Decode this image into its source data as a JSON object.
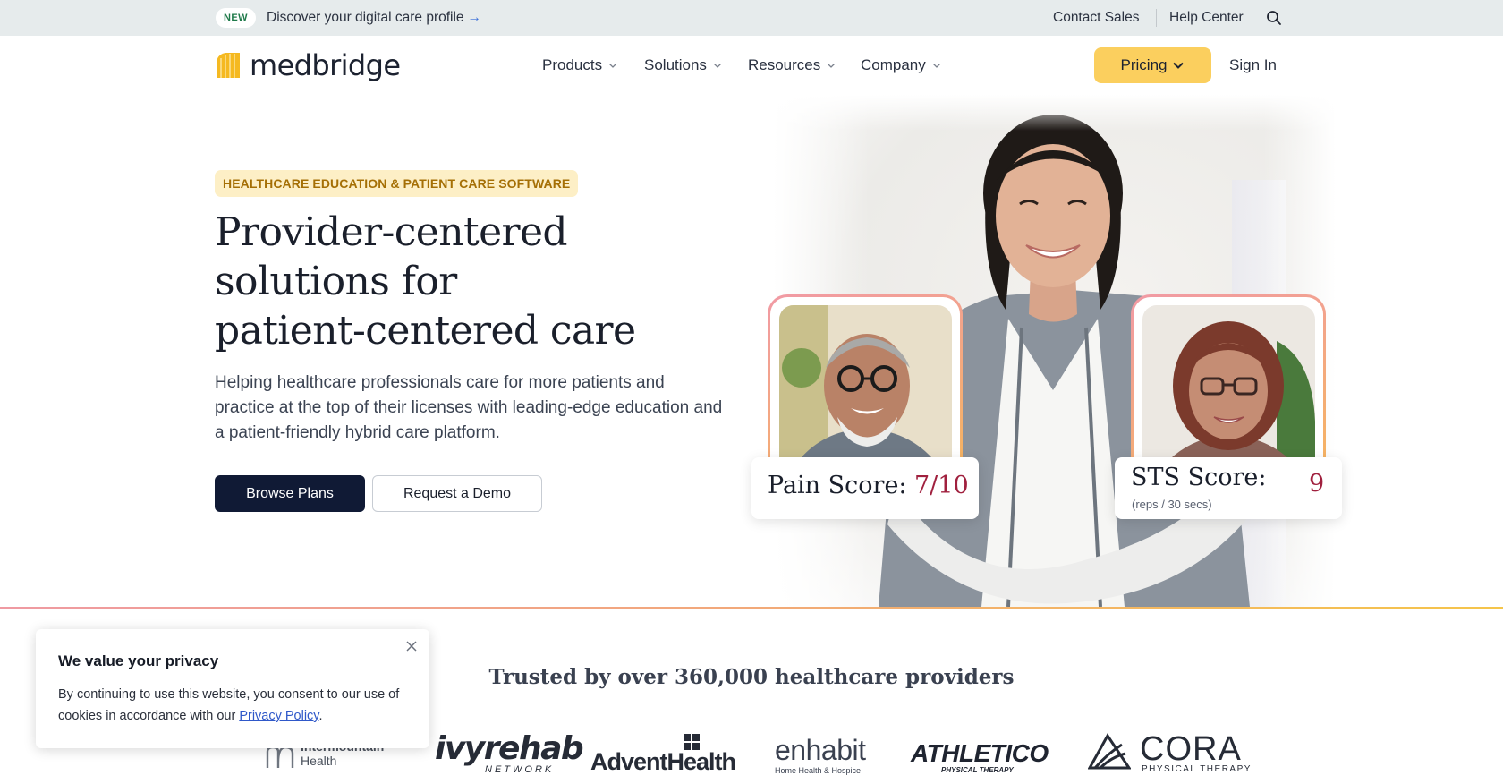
{
  "announcement": {
    "badge": "NEW",
    "text": "Discover your digital care profile",
    "arrow": "→",
    "contact_sales": "Contact Sales",
    "help_center": "Help Center",
    "search_icon": "search-icon"
  },
  "nav": {
    "brand": "medbridge",
    "menu": [
      {
        "label": "Products"
      },
      {
        "label": "Solutions"
      },
      {
        "label": "Resources"
      },
      {
        "label": "Company"
      }
    ],
    "pricing": "Pricing",
    "sign_in": "Sign In"
  },
  "hero": {
    "eyebrow": "HEALTHCARE EDUCATION & PATIENT CARE SOFTWARE",
    "headline_line1": "Provider-centered",
    "headline_line2": "solutions for",
    "headline_line3": "patient-centered care",
    "subcopy": "Helping healthcare professionals care for more patients and practice at the top of their licenses with leading-edge education and a patient-friendly hybrid care platform.",
    "primary_cta": "Browse Plans",
    "secondary_cta": "Request a Demo"
  },
  "cards": {
    "pain_label": "Pain Score:",
    "pain_value": "7/10",
    "sts_label": "STS Score:",
    "sts_value": "9",
    "sts_note": "(reps / 30 secs)"
  },
  "trusted": {
    "heading": "Trusted by over 360,000 healthcare providers",
    "logos": [
      {
        "line1": "Intermountain",
        "line2": "Health"
      },
      {
        "line1": "ivyrehab",
        "line2": "NETWORK"
      },
      {
        "line1": "AdventHealth"
      },
      {
        "line1": "enhabit",
        "line2": "Home Health & Hospice"
      },
      {
        "line1": "ATHLETICO",
        "line2": "PHYSICAL THERAPY"
      },
      {
        "line1": "CORA",
        "line2": "PHYSICAL THERAPY"
      }
    ]
  },
  "cookie": {
    "title": "We value your privacy",
    "body_pre": "By continuing to use this website, you consent to our use of cookies in accordance with our ",
    "link": "Privacy Policy",
    "body_post": "."
  },
  "colors": {
    "accent_yellow": "#fbcf5e",
    "navy": "#101a35",
    "score_red": "#a0203e"
  }
}
